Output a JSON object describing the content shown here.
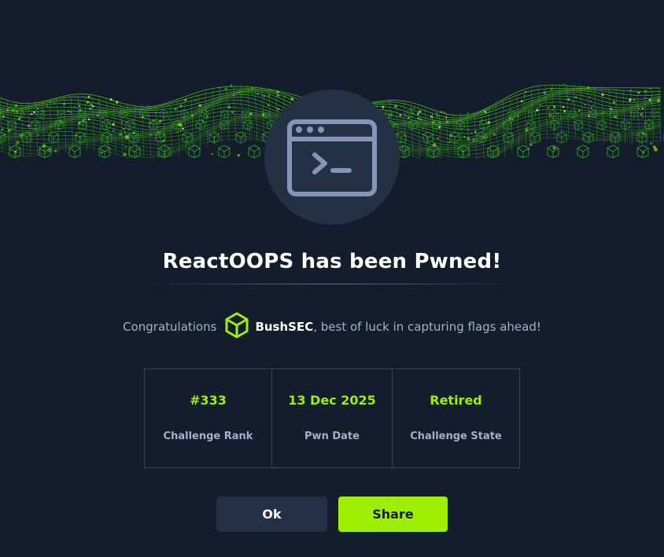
{
  "modal": {
    "title": "ReactOOPS has been Pwned!",
    "congrats_prefix": "Congratulations",
    "username": "BushSEC",
    "congrats_suffix": ", best of luck in capturing flags ahead!",
    "badge_icon": "terminal-window-icon",
    "avatar_icon": "hexagon-cube-icon"
  },
  "stats": [
    {
      "value": "#333",
      "label": "Challenge Rank"
    },
    {
      "value": "13 Dec 2025",
      "label": "Pwn Date"
    },
    {
      "value": "Retired",
      "label": "Challenge State"
    }
  ],
  "buttons": {
    "ok_label": "Ok",
    "share_label": "Share"
  },
  "colors": {
    "background": "#141d2b",
    "panel": "#243043",
    "accent": "#9fef00",
    "muted_text": "#a4b1cd",
    "border": "#3a4559"
  }
}
